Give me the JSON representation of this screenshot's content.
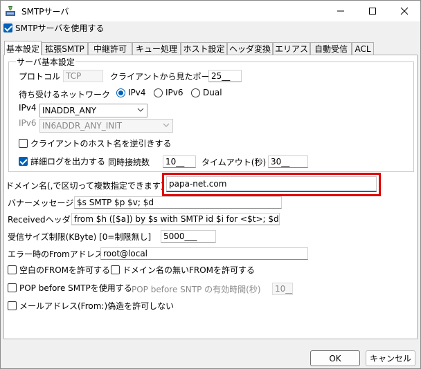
{
  "window": {
    "title": "SMTPサーバ"
  },
  "use_smtp": {
    "label": "SMTPサーバを使用する",
    "checked": true
  },
  "tabs": [
    {
      "label": "基本設定",
      "active": true
    },
    {
      "label": "拡張SMTP"
    },
    {
      "label": "中継許可"
    },
    {
      "label": "キュー処理"
    },
    {
      "label": "ホスト設定"
    },
    {
      "label": "ヘッダ変換"
    },
    {
      "label": "エリアス"
    },
    {
      "label": "自動受信"
    },
    {
      "label": "ACL"
    }
  ],
  "basic": {
    "group_title": "サーバ基本設定",
    "protocol_label": "プロトコル",
    "protocol_value": "TCP",
    "port_label": "クライアントから見たポート",
    "port_value": "25__",
    "network_label": "待ち受けるネットワーク",
    "net_options": [
      "IPv4",
      "IPv6",
      "Dual"
    ],
    "net_selected": "IPv4",
    "ipv4_label": "IPv4",
    "ipv4_value": "INADDR_ANY",
    "ipv6_label": "IPv6",
    "ipv6_value": "IN6ADDR_ANY_INIT",
    "reverse_lookup_label": "クライアントのホスト名を逆引きする",
    "reverse_lookup_checked": false,
    "detail_log_label": "詳細ログを出力する",
    "detail_log_checked": true,
    "concurrent_label": "同時接続数",
    "concurrent_value": "10__",
    "timeout_label": "タイムアウト(秒)",
    "timeout_value": "30__"
  },
  "domain": {
    "label": "ドメイン名(,で区切って複数指定できます)",
    "value": "papa-net.com"
  },
  "banner": {
    "label": "バナーメッセージ",
    "value": "$s SMTP $p $v; $d"
  },
  "received": {
    "label": "Receivedヘッダ",
    "value": "from $h ([$a]) by $s with SMTP id $i for <$t>; $d"
  },
  "recv_size": {
    "label": "受信サイズ制限(KByte)  [0=制限無し]",
    "value": "5000___"
  },
  "error_from": {
    "label": "エラー時のFromアドレス",
    "value": "root@local"
  },
  "allow_empty_from": {
    "label": "空白のFROMを許可する",
    "checked": false
  },
  "allow_no_domain_from": {
    "label": "ドメイン名の無いFROMを許可する",
    "checked": false
  },
  "pop_before_smtp": {
    "label": "POP before SMTPを使用する",
    "checked": false
  },
  "pop_valid_time": {
    "label": "POP before SNTP の有効時間(秒)",
    "value": "10__"
  },
  "disallow_spoof": {
    "label": "メールアドレス(From:)偽造を許可しない",
    "checked": false
  },
  "buttons": {
    "ok": "OK",
    "cancel": "キャンセル"
  }
}
